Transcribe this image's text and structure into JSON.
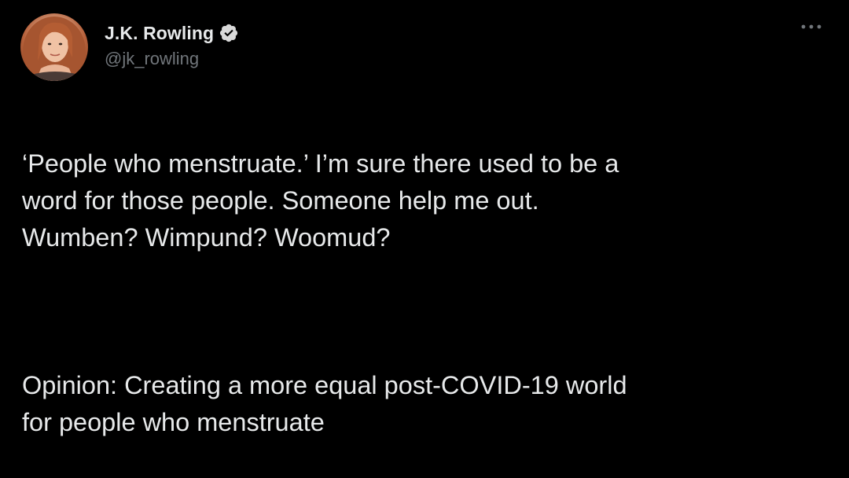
{
  "tweet": {
    "author": {
      "display_name": "J.K. Rowling",
      "handle": "@jk_rowling",
      "verified": true
    },
    "more_icon": "more-horizontal-icon",
    "text_paragraphs": [
      "‘People who menstruate.’ I’m sure there used to be a\nword for those people. Someone help me out.\nWumben? Wimpund? Woomud?",
      "Opinion: Creating a more equal post-COVID-19 world\nfor people who menstruate"
    ],
    "colors": {
      "background": "#000000",
      "primary_text": "#e7e9ea",
      "secondary_text": "#71767b",
      "verified_badge": "#d9d9d9"
    }
  }
}
